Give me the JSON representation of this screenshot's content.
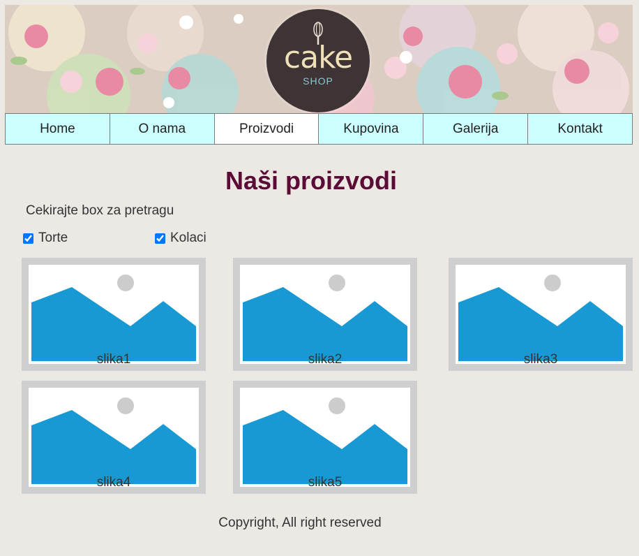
{
  "header": {
    "logo_main": "cake",
    "logo_sub": "SHOP"
  },
  "nav": {
    "items": [
      {
        "label": "Home",
        "active": false
      },
      {
        "label": "O nama",
        "active": false
      },
      {
        "label": "Proizvodi",
        "active": true
      },
      {
        "label": "Kupovina",
        "active": false
      },
      {
        "label": "Galerija",
        "active": false
      },
      {
        "label": "Kontakt",
        "active": false
      }
    ]
  },
  "main": {
    "title": "Naši proizvodi",
    "hint": "Cekirajte box za pretragu",
    "filters": [
      {
        "label": "Torte",
        "checked": true
      },
      {
        "label": "Kolaci",
        "checked": true
      }
    ],
    "products": [
      {
        "caption": "slika1",
        "icon": "image-placeholder-icon"
      },
      {
        "caption": "slika2",
        "icon": "image-placeholder-icon"
      },
      {
        "caption": "slika3",
        "icon": "image-placeholder-icon"
      },
      {
        "caption": "slika4",
        "icon": "image-placeholder-icon"
      },
      {
        "caption": "slika5",
        "icon": "image-placeholder-icon"
      }
    ]
  },
  "footer": {
    "text": "Copyright, All right reserved"
  },
  "colors": {
    "page_bg": "#ece9e5",
    "nav_bg": "#ccffff",
    "nav_active_bg": "#ffffff",
    "title": "#5b0b35",
    "placeholder_blue": "#1899d3"
  }
}
